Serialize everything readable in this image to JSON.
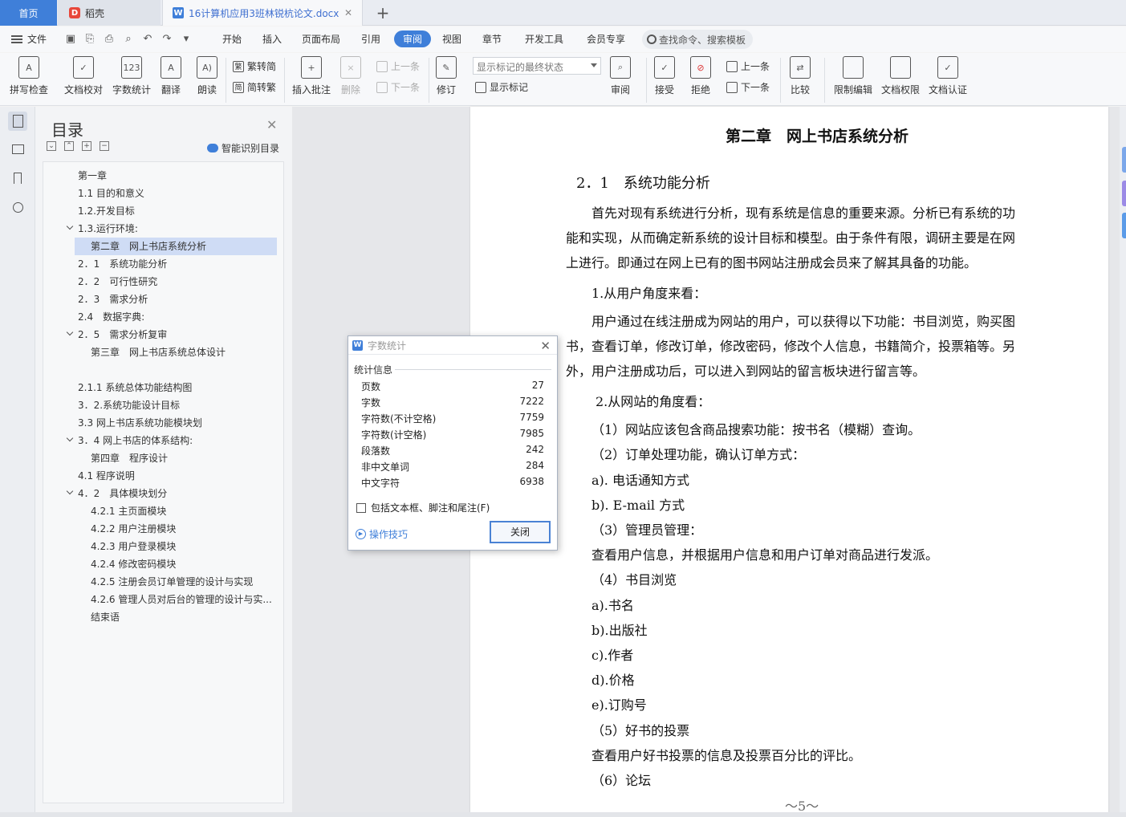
{
  "tabs": {
    "home": "首页",
    "daoke": "稻壳",
    "doc": "16计算机应用3班林锐杭论文.docx"
  },
  "menu": {
    "file": "文件",
    "items": [
      "开始",
      "插入",
      "页面布局",
      "引用",
      "审阅",
      "视图",
      "章节",
      "开发工具",
      "会员专享"
    ],
    "active": "审阅",
    "search_placeholder": "查找命令、搜索模板"
  },
  "ribbon": {
    "spell": "拼写检查",
    "proof": "文档校对",
    "wordcount": "字数统计",
    "translate": "翻译",
    "read": "朗读",
    "to_traditional": "繁转简",
    "to_simplified": "简转繁",
    "insert_comment": "插入批注",
    "delete": "删除",
    "prev": "上一条",
    "next": "下一条",
    "revise": "修订",
    "markup_state": "显示标记的最终状态",
    "show_markup": "显示标记",
    "review": "审阅",
    "accept": "接受",
    "reject": "拒绝",
    "prev2": "上一条",
    "next2": "下一条",
    "compare": "比较",
    "restrict_edit": "限制编辑",
    "doc_perm": "文档权限",
    "doc_cert": "文档认证"
  },
  "toc": {
    "title": "目录",
    "smart": "智能识别目录",
    "items": [
      {
        "text": "第一章"
      },
      {
        "text": "1.1 目的和意义"
      },
      {
        "text": "1.2.开发目标"
      },
      {
        "text": "1.3.运行环境:"
      },
      {
        "text": "第二章　网上书店系统分析"
      },
      {
        "text": "2．1　系统功能分析"
      },
      {
        "text": "2．2　可行性研究"
      },
      {
        "text": "2．3　需求分析"
      },
      {
        "text": "2.4　数据字典:"
      },
      {
        "text": "2．5　需求分析复审"
      },
      {
        "text": "第三章　网上书店系统总体设计"
      },
      {
        "text": "2.1.1  系统总体功能结构图"
      },
      {
        "text": "3．2.系统功能设计目标"
      },
      {
        "text": "3.3  网上书店系统功能模块划"
      },
      {
        "text": "3．4  网上书店的体系结构:"
      },
      {
        "text": "第四章　程序设计"
      },
      {
        "text": "4.1 程序说明"
      },
      {
        "text": "4．2　具体模块划分"
      },
      {
        "text": "4.2.1 主页面模块"
      },
      {
        "text": "4.2.2  用户注册模块"
      },
      {
        "text": "4.2.3  用户登录模块"
      },
      {
        "text": "4.2.4 修改密码模块"
      },
      {
        "text": "4.2.5 注册会员订单管理的设计与实现"
      },
      {
        "text": "4.2.6 管理人员对后台的管理的设计与实..."
      },
      {
        "text": "结束语"
      }
    ]
  },
  "document": {
    "chapter_title": "第二章　网上书店系统分析",
    "section_title": "2．1　系统功能分析",
    "lines": [
      "首先对现有系统进行分析，现有系统是信息的重要来源。分析已有系统的功",
      "能和实现，从而确定新系统的设计目标和模型。由于条件有限，调研主要是在网",
      "上进行。即通过在网上已有的图书网站注册成会员来了解其具备的功能。",
      "1.从用户角度来看：",
      "用户通过在线注册成为网站的用户，可以获得以下功能：书目浏览，购买图",
      "书，查看订单，修改订单，修改密码，修改个人信息，书籍简介，投票箱等。另",
      "外，用户注册成功后，可以进入到网站的留言板块进行留言等。",
      "2.从网站的角度看：",
      "（1）网站应该包含商品搜索功能：按书名（模糊）查询。",
      "（2）订单处理功能，确认订单方式：",
      "a).  电话通知方式",
      "b).    E-mail 方式",
      "（3）管理员管理：",
      "查看用户信息，并根据用户信息和用户订单对商品进行发派。",
      "（4）书目浏览",
      "a).书名",
      "b).出版社",
      "c).作者",
      "d).价格",
      "e).订购号",
      "（5）好书的投票",
      "查看用户好书投票的信息及投票百分比的评比。",
      "（6）论坛"
    ],
    "page_number": "～5～"
  },
  "dialog": {
    "title": "字数统计",
    "section": "统计信息",
    "stats": [
      {
        "label": "页数",
        "value": "27"
      },
      {
        "label": "字数",
        "value": "7222"
      },
      {
        "label": "字符数(不计空格)",
        "value": "7759"
      },
      {
        "label": "字符数(计空格)",
        "value": "7985"
      },
      {
        "label": "段落数",
        "value": "242"
      },
      {
        "label": "非中文单词",
        "value": "284"
      },
      {
        "label": "中文字符",
        "value": "6938"
      }
    ],
    "checkbox": "包括文本框、脚注和尾注(F)",
    "tips": "操作技巧",
    "close_button": "关闭"
  },
  "colors": {
    "accent": "#3f7fd9",
    "toc_selected": "#cfdcf5"
  }
}
